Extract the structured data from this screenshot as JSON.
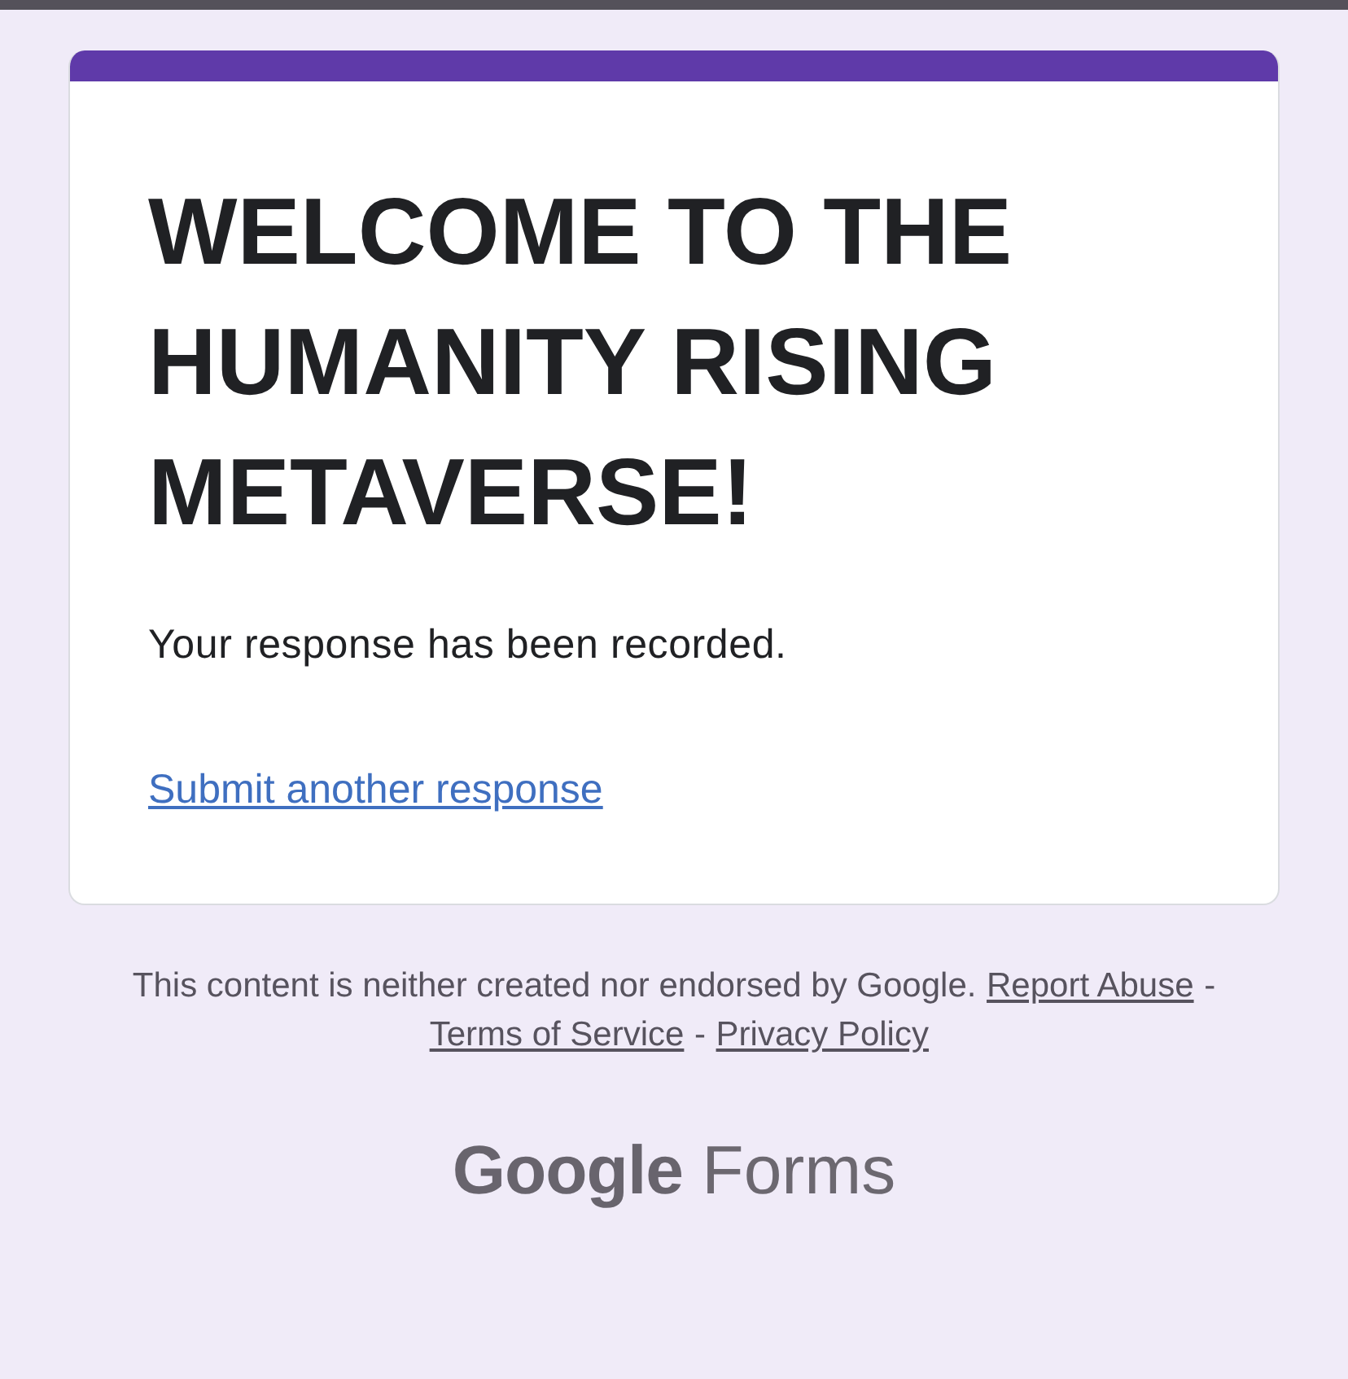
{
  "form": {
    "title": "WELCOME TO THE HUMANITY RISING METAVERSE!",
    "message": "Your response has been recorded.",
    "link": "Submit another response"
  },
  "footer": {
    "disclaimer": "This content is neither created nor endorsed by Google.",
    "links": [
      {
        "label": "Report Abuse"
      },
      {
        "label": "Terms of Service"
      },
      {
        "label": "Privacy Policy"
      }
    ],
    "separators": [
      "-",
      "-"
    ],
    "logo": {
      "brand": "Google",
      "product": "Forms"
    }
  }
}
